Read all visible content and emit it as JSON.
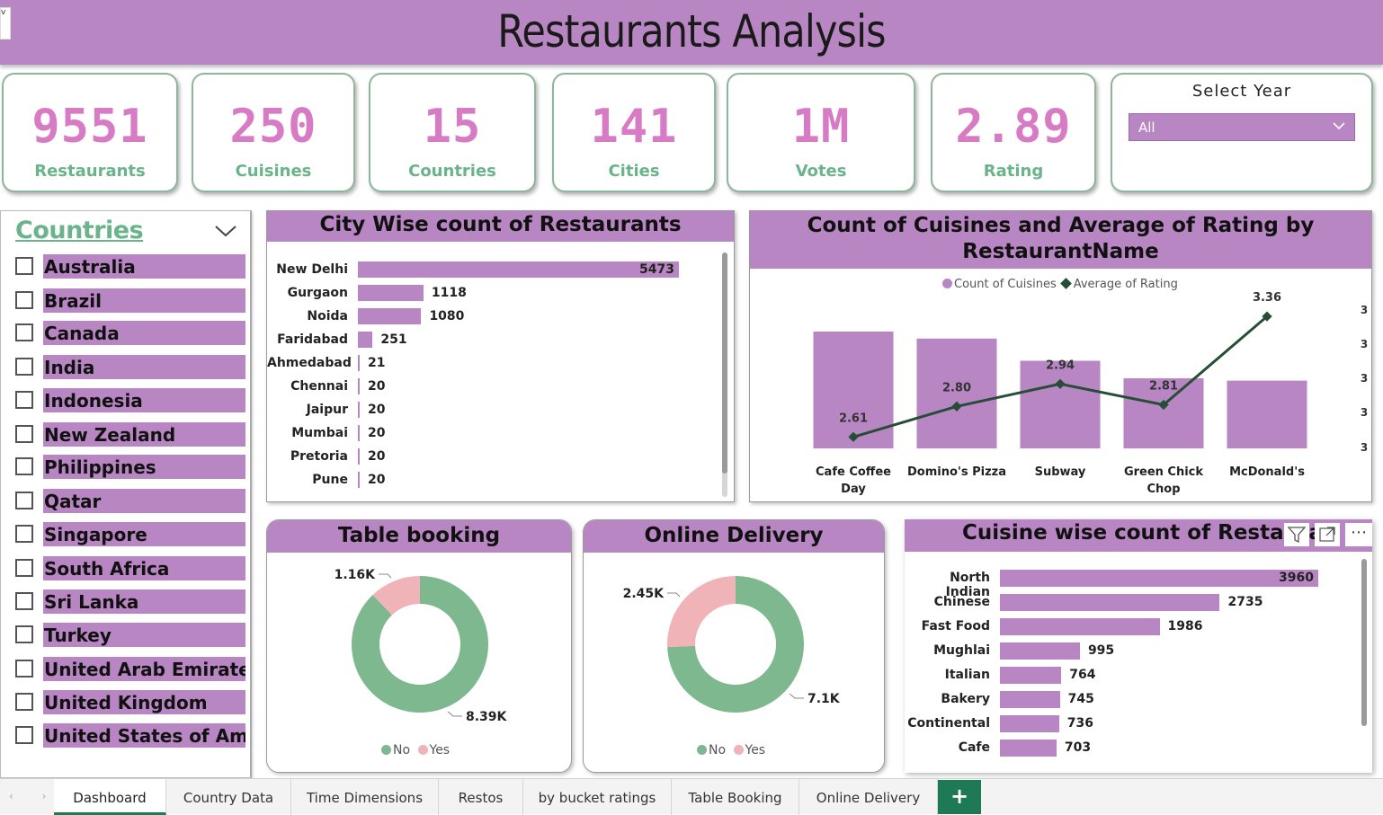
{
  "header": {
    "title": "Restaurants Analysis",
    "corner": "v"
  },
  "kpis": [
    {
      "value": "9551",
      "label": "Restaurants"
    },
    {
      "value": "250",
      "label": "Cuisines"
    },
    {
      "value": "15",
      "label": "Countries"
    },
    {
      "value": "141",
      "label": "Cities"
    },
    {
      "value": "1M",
      "label": "Votes"
    },
    {
      "value": "2.89",
      "label": "Rating"
    }
  ],
  "year_filter": {
    "label": "Select Year",
    "selected": "All"
  },
  "countries_slicer": {
    "title": "Countries",
    "items": [
      "Australia",
      "Brazil",
      "Canada",
      "India",
      "Indonesia",
      "New Zealand",
      "Philippines",
      "Qatar",
      "Singapore",
      "South Africa",
      "Sri Lanka",
      "Turkey",
      "United Arab Emirates",
      "United Kingdom",
      "United States of Am..."
    ]
  },
  "city_chart": {
    "title": "City Wise count of Restaurants"
  },
  "combo_chart": {
    "title_line1": "Count of Cuisines and Average of Rating by",
    "title_line2": "RestaurantName",
    "legend_bar": "Count of Cuisines",
    "legend_line": "Average of Rating",
    "right_axis_ticks": [
      "3",
      "3",
      "3",
      "3",
      "3"
    ]
  },
  "table_booking": {
    "title": "Table booking",
    "yes_label": "1.16K",
    "no_label": "8.39K",
    "legend_no": "No",
    "legend_yes": "Yes"
  },
  "online_delivery": {
    "title": "Online Delivery",
    "yes_label": "2.45K",
    "no_label": "7.1K",
    "legend_no": "No",
    "legend_yes": "Yes"
  },
  "cuisine_chart": {
    "title": "Cuisine wise count of Restaura"
  },
  "tabs": [
    "Dashboard",
    "Country Data",
    "Time Dimensions",
    "Restos",
    "by bucket ratings",
    "Table Booking",
    "Online Delivery"
  ],
  "add_tab": "+",
  "nav_arrows": "‹ ›",
  "more_icon": "⋯",
  "colors": {
    "accent": "#b986c4",
    "kpi_value": "#d77bc4",
    "kpi_label": "#6bb38a",
    "no": "#7db88f",
    "yes": "#f0b3b8",
    "line": "#264d36",
    "tab_active": "#1e7a55"
  },
  "chart_data": [
    {
      "type": "bar",
      "orientation": "horizontal",
      "title": "City Wise count of Restaurants",
      "categories": [
        "New Delhi",
        "Gurgaon",
        "Noida",
        "Faridabad",
        "Ahmedabad",
        "Chennai",
        "Jaipur",
        "Mumbai",
        "Pretoria",
        "Pune"
      ],
      "values": [
        5473,
        1118,
        1080,
        251,
        21,
        20,
        20,
        20,
        20,
        20
      ]
    },
    {
      "type": "bar",
      "subtype": "bar+line combo",
      "title": "Count of Cuisines and Average of Rating by RestaurantName",
      "categories": [
        "Cafe Coffee Day",
        "Domino's Pizza",
        "Subway",
        "Green Chick Chop",
        "McDonald's"
      ],
      "series": [
        {
          "name": "Count of Cuisines",
          "type": "bar",
          "values": [
            1,
            0.94,
            0.75,
            0.6,
            0.58
          ]
        },
        {
          "name": "Average of Rating",
          "type": "line",
          "values": [
            2.61,
            2.8,
            2.94,
            2.81,
            3.36
          ]
        }
      ]
    },
    {
      "type": "pie",
      "subtype": "donut",
      "title": "Table booking",
      "categories": [
        "No",
        "Yes"
      ],
      "values": [
        8390,
        1160
      ]
    },
    {
      "type": "pie",
      "subtype": "donut",
      "title": "Online Delivery",
      "categories": [
        "No",
        "Yes"
      ],
      "values": [
        7100,
        2450
      ]
    },
    {
      "type": "bar",
      "orientation": "horizontal",
      "title": "Cuisine wise count of Restaurants",
      "categories": [
        "North Indian",
        "Chinese",
        "Fast Food",
        "Mughlai",
        "Italian",
        "Bakery",
        "Continental",
        "Cafe"
      ],
      "values": [
        3960,
        2735,
        1986,
        995,
        764,
        745,
        736,
        703
      ]
    }
  ]
}
